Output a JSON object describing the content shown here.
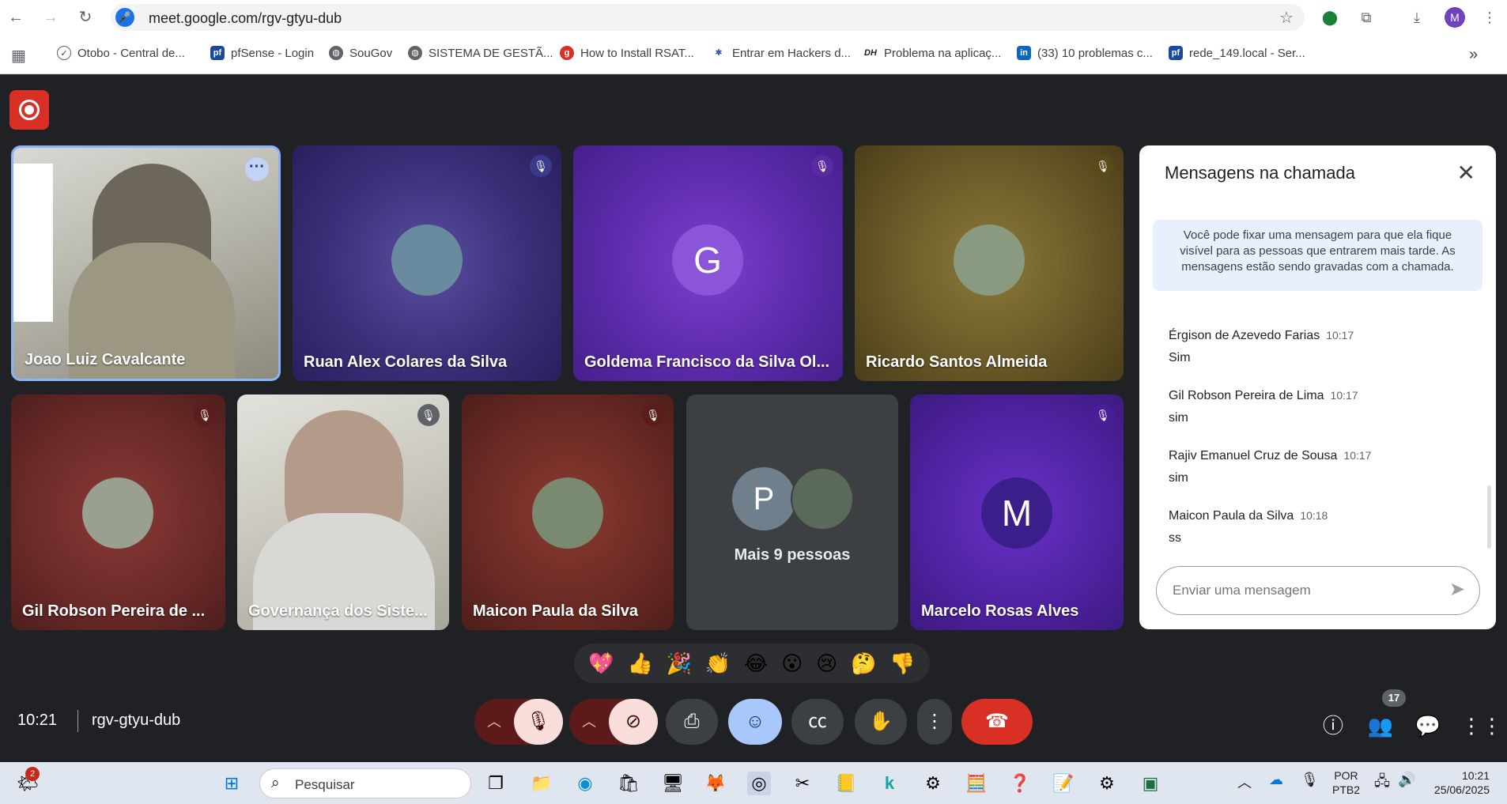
{
  "browser": {
    "url": "meet.google.com/rgv-gtyu-dub",
    "profile_initial": "M",
    "bookmarks": [
      {
        "label": "Otobo - Central de..."
      },
      {
        "label": "pfSense - Login"
      },
      {
        "label": "SouGov"
      },
      {
        "label": "SISTEMA DE GESTÃ..."
      },
      {
        "label": "How to Install RSAT..."
      },
      {
        "label": "Entrar em Hackers d..."
      },
      {
        "label": "Problema na aplicaç..."
      },
      {
        "label": "(33) 10 problemas c..."
      },
      {
        "label": "rede_149.local - Ser..."
      }
    ]
  },
  "tiles": [
    {
      "name": "Joao Luiz Cavalcante"
    },
    {
      "name": "Ruan Alex Colares da Silva"
    },
    {
      "name": "Goldema Francisco da Silva Ol...",
      "initial": "G"
    },
    {
      "name": "Ricardo Santos Almeida"
    },
    {
      "name": "Gil Robson Pereira de ..."
    },
    {
      "name": "Governança dos Siste..."
    },
    {
      "name": "Maicon Paula da Silva"
    },
    {
      "name": "Mais 9 pessoas",
      "initial": "P"
    },
    {
      "name": "Marcelo Rosas Alves",
      "initial": "M"
    }
  ],
  "chat": {
    "title": "Mensagens na chamada",
    "note": "Você pode fixar uma mensagem para que ela fique visível para as pessoas que entrarem mais tarde. As mensagens estão sendo gravadas com a chamada.",
    "messages": [
      {
        "sender": "Érgison de Azevedo Farias",
        "time": "10:17",
        "text": "Sim"
      },
      {
        "sender": "Gil Robson Pereira de Lima",
        "time": "10:17",
        "text": "sim"
      },
      {
        "sender": "Rajiv Emanuel Cruz de Sousa",
        "time": "10:17",
        "text": "sim"
      },
      {
        "sender": "Maicon Paula da Silva",
        "time": "10:18",
        "text": "ss"
      }
    ],
    "input_placeholder": "Enviar uma mensagem"
  },
  "reactions": [
    "💖",
    "👍",
    "🎉",
    "👏",
    "😂",
    "😮",
    "😢",
    "🤔",
    "👎"
  ],
  "controls": {
    "clock": "10:21",
    "meeting_code": "rgv-gtyu-dub",
    "participants_count": "17"
  },
  "taskbar": {
    "notification_count": "2",
    "search_label": "Pesquisar",
    "lang_top": "POR",
    "lang_bottom": "PTB2",
    "time": "10:21",
    "date": "25/06/2025"
  }
}
